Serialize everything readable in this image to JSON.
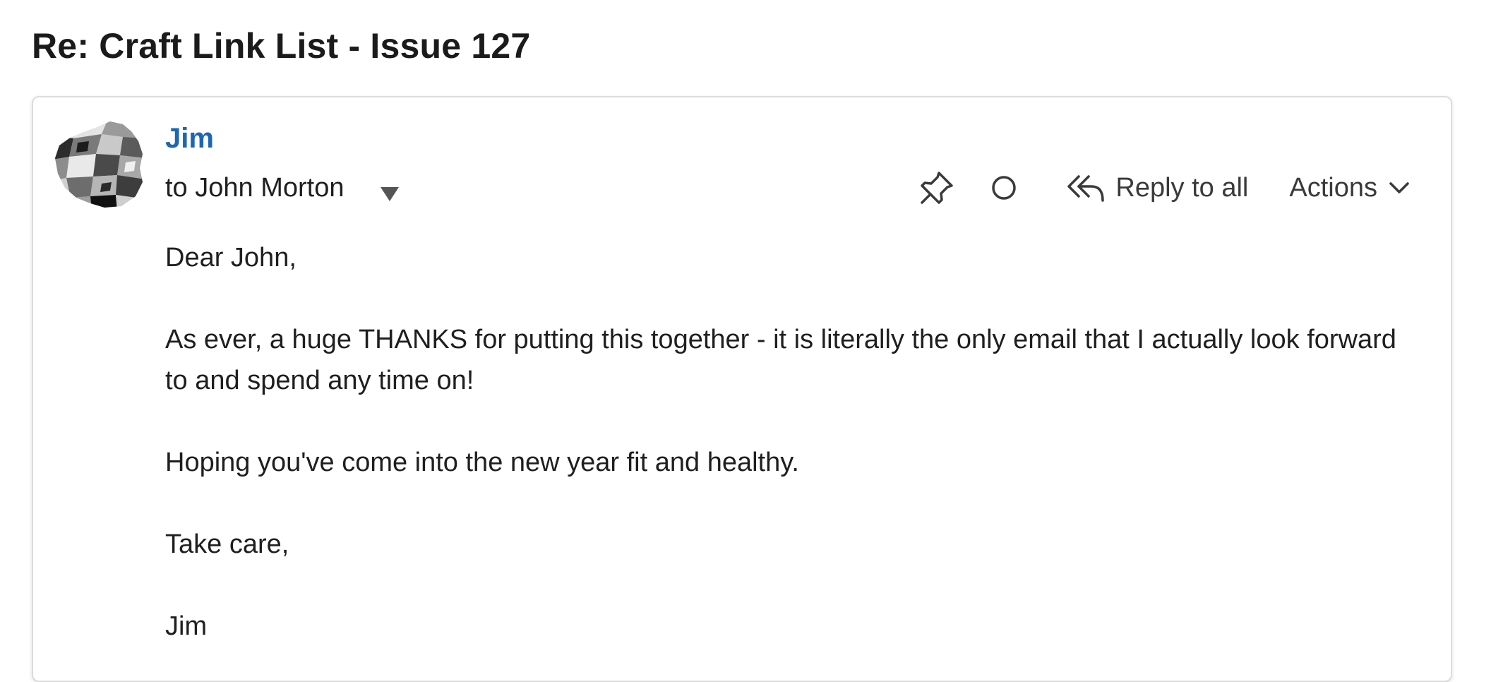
{
  "email": {
    "subject": "Re: Craft Link List - Issue 127",
    "sender": "Jim",
    "recipient_line": "to John Morton",
    "toolbar": {
      "reply_all_label": "Reply to all",
      "actions_label": "Actions"
    },
    "body": {
      "greeting": "Dear John,",
      "paragraph_1": "As ever, a huge THANKS for putting this together - it is literally the only email that I actually look forward to and spend any time on!",
      "paragraph_2": "Hoping you've come into the new year fit and healthy.",
      "closing": "Take care,",
      "signature": "Jim"
    }
  },
  "colors": {
    "sender_link": "#1d66b4",
    "text": "#1f1f1f",
    "card_border": "#dcdcdc"
  },
  "icons": {
    "avatar": "grayscale-mosaic-avatar",
    "recipient_toggle": "triangle-down-icon",
    "pin": "pin-icon",
    "mark": "circle-icon",
    "reply_all": "reply-all-icon",
    "actions": "chevron-down-icon"
  }
}
